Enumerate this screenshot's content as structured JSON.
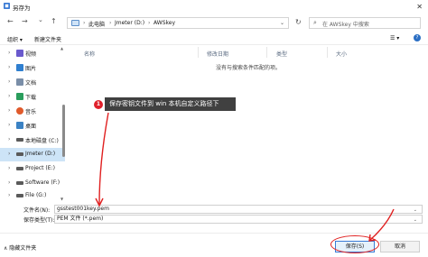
{
  "window": {
    "title": "另存为",
    "close_glyph": "✕"
  },
  "nav": {
    "back": "←",
    "forward": "→",
    "up_menu": "⌄",
    "up": "↑",
    "breadcrumb": [
      "此电脑",
      "Jmeter (D:)",
      "AWSkey"
    ],
    "refresh": "↻",
    "search_placeholder": "在 AWSkey 中搜索"
  },
  "toolbar": {
    "organize": "组织 ▾",
    "new_folder": "新建文件夹",
    "view": "☰ ▾",
    "help": "?"
  },
  "sidebar": {
    "items": [
      {
        "label": "视频",
        "icon": "video-folder-icon",
        "color": "#6a5acd"
      },
      {
        "label": "图片",
        "icon": "pictures-folder-icon",
        "color": "#2f7fd0"
      },
      {
        "label": "文档",
        "icon": "documents-folder-icon",
        "color": "#7a8ea8"
      },
      {
        "label": "下载",
        "icon": "downloads-folder-icon",
        "color": "#2a9d5c"
      },
      {
        "label": "音乐",
        "icon": "music-folder-icon",
        "color": "#e05a2b"
      },
      {
        "label": "桌面",
        "icon": "desktop-folder-icon",
        "color": "#3b82c4"
      },
      {
        "label": "本地磁盘 (C:)",
        "icon": "drive-icon",
        "color": "#5a5a5a"
      },
      {
        "label": "Jmeter (D:)",
        "icon": "drive-icon",
        "color": "#5a5a5a",
        "selected": true
      },
      {
        "label": "Project (E:)",
        "icon": "drive-icon",
        "color": "#5a5a5a"
      },
      {
        "label": "Software (F:)",
        "icon": "drive-icon",
        "color": "#5a5a5a"
      },
      {
        "label": "File (G:)",
        "icon": "drive-icon",
        "color": "#5a5a5a"
      }
    ]
  },
  "columns": {
    "name": "名称",
    "modified": "修改日期",
    "type": "类型",
    "size": "大小"
  },
  "empty_message": "没有与搜索条件匹配的项。",
  "annotation": {
    "badge": "1",
    "text": "保存密钥文件到 win 本机自定义路径下"
  },
  "form": {
    "filename_label": "文件名(N):",
    "filename_value": "gsstest001key.pem",
    "filetype_label": "保存类型(T):",
    "filetype_value": "PEM 文件 (*.pem)"
  },
  "footer": {
    "hide_folders": "∧ 隐藏文件夹",
    "save": "保存(S)",
    "cancel": "取消"
  },
  "colors": {
    "accent": "#2b6fc4",
    "annotation_red": "#e02020",
    "selection": "#cde4f7"
  }
}
